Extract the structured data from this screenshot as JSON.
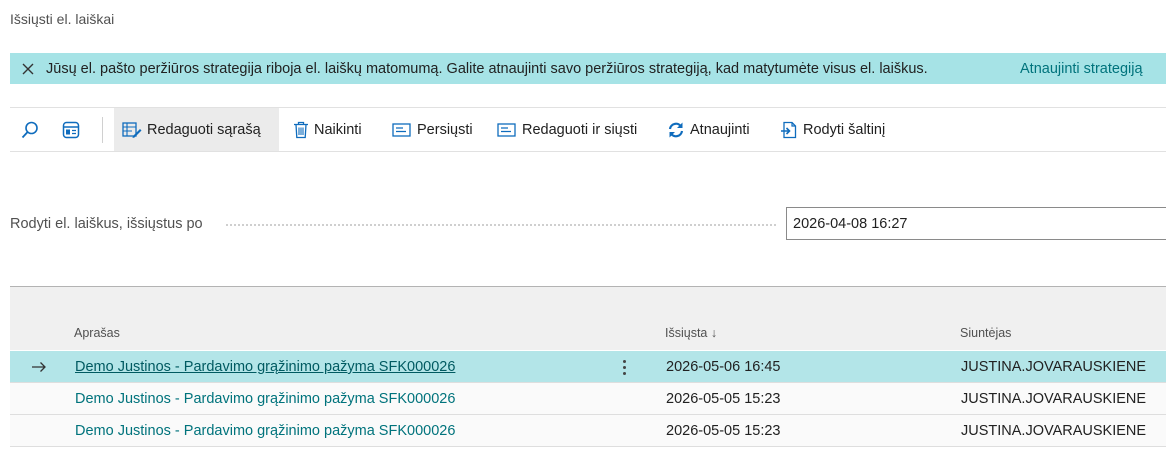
{
  "page": {
    "title": "Išsiųsti el. laiškai"
  },
  "banner": {
    "message": "Jūsų el. pašto peržiūros strategija riboja el. laiškų matomumą. Galite atnaujinti savo peržiūros strategiją, kad matytumėte visus el. laiškus.",
    "action_label": "Atnaujinti strategiją",
    "color": "#a6e3e6"
  },
  "toolbar": {
    "search_icon": "search-icon",
    "layout_icon": "layout-icon",
    "edit_list_label": "Redaguoti sąrašą",
    "delete_label": "Naikinti",
    "forward_label": "Persiųsti",
    "edit_and_send_label": "Redaguoti ir siųsti",
    "refresh_label": "Atnaujinti",
    "show_source_label": "Rodyti šaltinį"
  },
  "filter": {
    "label": "Rodyti el. laiškus, išsiųstus po",
    "value": "2026-04-08 16:27"
  },
  "grid": {
    "columns": {
      "description": "Aprašas",
      "sent": "Išsiųsta",
      "sent_sort": "↓",
      "sender": "Siuntėjas"
    },
    "rows": [
      {
        "description": "Demo Justinos - Pardavimo grąžinimo pažyma SFK000026",
        "sent": "2026-05-06 16:45",
        "sender": "JUSTINA.JOVARAUSKIENE",
        "selected": true
      },
      {
        "description": "Demo Justinos - Pardavimo grąžinimo pažyma SFK000026",
        "sent": "2026-05-05 15:23",
        "sender": "JUSTINA.JOVARAUSKIENE",
        "selected": false
      },
      {
        "description": "Demo Justinos - Pardavimo grąžinimo pažyma SFK000026",
        "sent": "2026-05-05 15:23",
        "sender": "JUSTINA.JOVARAUSKIENE",
        "selected": false
      }
    ]
  },
  "colors": {
    "accent": "#00737c",
    "selected_row": "#b3e5e8",
    "icon_blue": "#0f6cbd"
  }
}
